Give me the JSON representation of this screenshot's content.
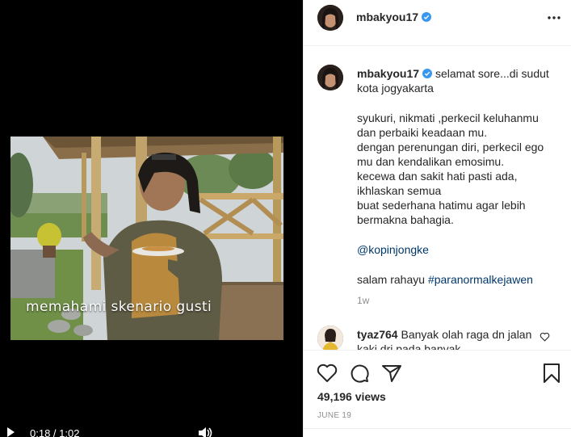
{
  "video": {
    "caption_overlay": "memahami skenario gusti",
    "time": "0:18 / 1:02"
  },
  "post": {
    "username": "mbakyou17",
    "caption_intro": "selamat sore...di sudut kota jogyakarta",
    "caption_body": "syukuri, nikmati ,perkecil keluhanmu\ndan perbaiki keadaan mu.\ndengan perenungan diri, perkecil ego\nmu dan kendalikan emosimu.\nkecewa dan sakit hati pasti ada,\nikhlaskan semua\nbuat sederhana hatimu agar lebih\nbermakna bahagia.",
    "mention": "@kopinjongke",
    "closing_text": "salam rahayu",
    "hashtag": "#paranormalkejawen",
    "time_ago": "1w",
    "views": "49,196 views",
    "date": "JUNE 19"
  },
  "comment": {
    "username": "tyaz764",
    "text": "Banyak olah raga dn jalan kaki dri pada banyak"
  },
  "icons": {
    "verified": "verified-badge-icon",
    "more": "more-options-icon",
    "heart": "heart-icon",
    "comment": "comment-icon",
    "share": "share-icon",
    "save": "bookmark-icon",
    "play": "play-icon",
    "volume": "volume-icon"
  },
  "colors": {
    "accent_blue": "#3897f0",
    "link_blue": "#00376b",
    "muted_gray": "#8e8e8e"
  }
}
